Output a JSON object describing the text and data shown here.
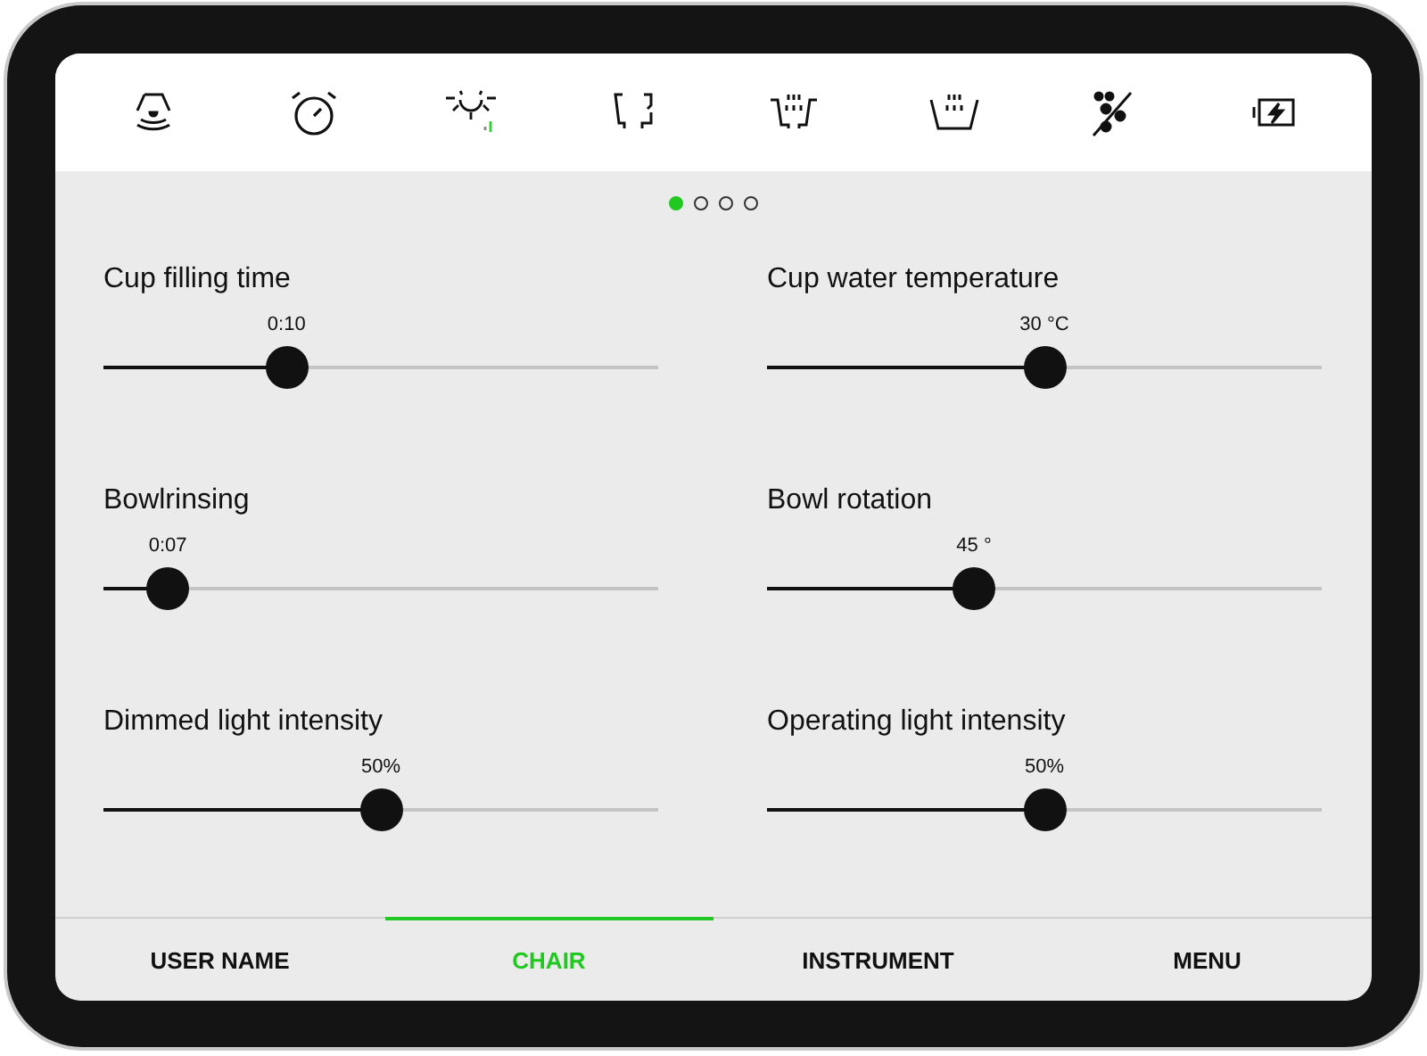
{
  "pages": [
    {
      "selected": true
    },
    {
      "selected": false
    },
    {
      "selected": false
    },
    {
      "selected": false
    }
  ],
  "settings": [
    {
      "label": "Cup filling time",
      "reading": "0:10",
      "level": 0.33
    },
    {
      "label": "Cup water temperature",
      "reading": "30 °C",
      "level": 0.5
    },
    {
      "label": "Bowlrinsing",
      "reading": "0:07",
      "level": 0.116
    },
    {
      "label": "Bowl rotation",
      "reading": "45 °",
      "level": 0.373
    },
    {
      "label": "Dimmed light intensity",
      "reading": "50%",
      "level": 0.5
    },
    {
      "label": "Operating light intensity",
      "reading": "50%",
      "level": 0.5
    }
  ],
  "tabs": [
    {
      "label": "USER NAME",
      "selected": false
    },
    {
      "label": "CHAIR",
      "selected": true
    },
    {
      "label": "INSTRUMENT",
      "selected": false
    },
    {
      "label": "MENU",
      "selected": false
    }
  ]
}
